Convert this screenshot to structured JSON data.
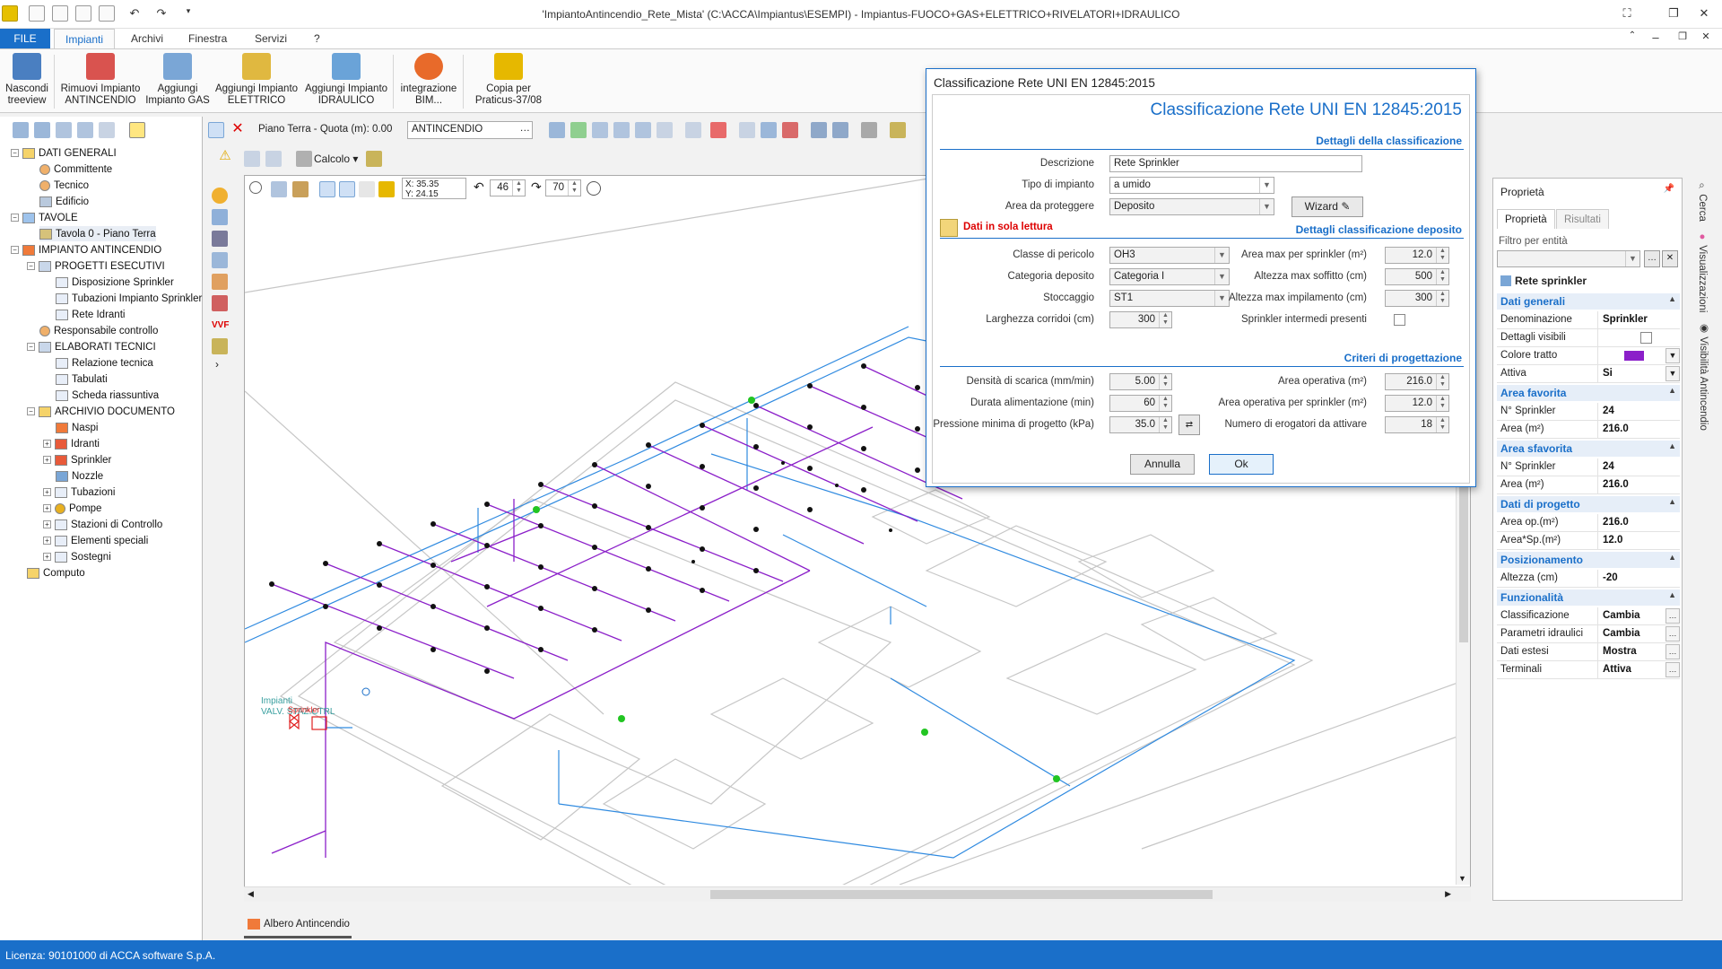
{
  "window": {
    "title": "'ImpiantoAntincendio_Rete_Mista' (C:\\ACCA\\Impiantus\\ESEMPI) - Impiantus-FUOCO+GAS+ELETTRICO+RIVELATORI+IDRAULICO"
  },
  "ribbon": {
    "tabs": [
      {
        "label": "FILE"
      },
      {
        "label": "Impianti"
      },
      {
        "label": "Archivi"
      },
      {
        "label": "Finestra"
      },
      {
        "label": "Servizi"
      },
      {
        "label": "?"
      }
    ],
    "buttons": [
      {
        "line1": "Nascondi",
        "line2": "treeview",
        "icon": "hide-tree-icon",
        "color": "#4a7fc1"
      },
      {
        "line1": "Rimuovi Impianto",
        "line2": "ANTINCENDIO",
        "icon": "remove-plant-icon",
        "color": "#d9534f"
      },
      {
        "line1": "Aggiungi",
        "line2": "Impianto GAS",
        "icon": "gas-plant-icon",
        "color": "#7aa6d6"
      },
      {
        "line1": "Aggiungi Impianto",
        "line2": "ELETTRICO",
        "icon": "electric-plant-icon",
        "color": "#e0b840"
      },
      {
        "line1": "Aggiungi Impianto",
        "line2": "IDRAULICO",
        "icon": "hydraulic-plant-icon",
        "color": "#6aa3d8"
      },
      {
        "line1": "integrazione",
        "line2": "BIM...",
        "icon": "bim-icon",
        "color": "#e86a2a"
      },
      {
        "line1": "Copia per",
        "line2": "Praticus-37/08",
        "icon": "praticus-icon",
        "color": "#e6b800"
      }
    ]
  },
  "tree": {
    "items": [
      {
        "label": "DATI GENERALI"
      },
      {
        "label": "Committente"
      },
      {
        "label": "Tecnico"
      },
      {
        "label": "Edificio"
      },
      {
        "label": "TAVOLE"
      },
      {
        "label": "Tavola 0 - Piano Terra"
      },
      {
        "label": "IMPIANTO ANTINCENDIO"
      },
      {
        "label": "PROGETTI ESECUTIVI"
      },
      {
        "label": "Disposizione Sprinkler"
      },
      {
        "label": "Tubazioni Impianto Sprinkler"
      },
      {
        "label": "Rete Idranti"
      },
      {
        "label": "Responsabile controllo"
      },
      {
        "label": "ELABORATI TECNICI"
      },
      {
        "label": "Relazione tecnica"
      },
      {
        "label": "Tabulati"
      },
      {
        "label": "Scheda riassuntiva"
      },
      {
        "label": "ARCHIVIO DOCUMENTO"
      },
      {
        "label": "Naspi"
      },
      {
        "label": "Idranti"
      },
      {
        "label": "Sprinkler"
      },
      {
        "label": "Nozzle"
      },
      {
        "label": "Tubazioni"
      },
      {
        "label": "Pompe"
      },
      {
        "label": "Stazioni di Controllo"
      },
      {
        "label": "Elementi speciali"
      },
      {
        "label": "Sostegni"
      },
      {
        "label": "Computo"
      }
    ]
  },
  "toolbar": {
    "floor": "Piano Terra - Quota (m): 0.00",
    "layer": "ANTINCENDIO",
    "calc": "Calcolo",
    "coord_x": "X: 35.35",
    "coord_y": "Y: 24.15",
    "angle1": "46",
    "angle2": "70"
  },
  "drawing": {
    "label_valv": "VALV. STAZ.CTRL",
    "label_sprinkler": "Sprinkler",
    "label_impianti": "Impianti"
  },
  "dialog": {
    "window_title": "Classificazione Rete UNI EN 12845:2015",
    "heading": "Classificazione Rete UNI EN 12845:2015",
    "section1": "Dettagli della classificazione",
    "descrizione_label": "Descrizione",
    "descrizione_value": "Rete Sprinkler",
    "tipo_label": "Tipo di impianto",
    "tipo_value": "a umido",
    "area_label": "Area da proteggere",
    "area_value": "Deposito",
    "wizard": "Wizard",
    "readonly": "Dati in sola lettura",
    "section2": "Dettagli classificazione deposito",
    "classe_label": "Classe di pericolo",
    "classe_value": "OH3",
    "categoria_label": "Categoria deposito",
    "categoria_value": "Categoria I",
    "stoccaggio_label": "Stoccaggio",
    "stoccaggio_value": "ST1",
    "larghezza_label": "Larghezza corridoi (cm)",
    "larghezza_value": "300",
    "areamax_label": "Area max per sprinkler (m²)",
    "areamax_value": "12.0",
    "altsoff_label": "Altezza max soffitto (cm)",
    "altsoff_value": "500",
    "altimp_label": "Altezza max impilamento (cm)",
    "altimp_value": "300",
    "intermedi_label": "Sprinkler intermedi presenti",
    "section3": "Criteri di progettazione",
    "densita_label": "Densità di scarica (mm/min)",
    "densita_value": "5.00",
    "durata_label": "Durata alimentazione (min)",
    "durata_value": "60",
    "pressione_label": "Pressione minima di progetto (kPa)",
    "pressione_value": "35.0",
    "areaop_label": "Area operativa (m²)",
    "areaop_value": "216.0",
    "areaopsp_label": "Area operativa per sprinkler (m²)",
    "areaopsp_value": "12.0",
    "numerog_label": "Numero di erogatori da attivare",
    "numerog_value": "18",
    "cancel": "Annulla",
    "ok": "Ok"
  },
  "props": {
    "title": "Proprietà",
    "tab1": "Proprietà",
    "tab2": "Risultati",
    "filter_label": "Filtro per entità",
    "entity": "Rete sprinkler",
    "groups": {
      "g1": "Dati generali",
      "g2": "Area favorita",
      "g3": "Area sfavorita",
      "g4": "Dati di progetto",
      "g5": "Posizionamento",
      "g6": "Funzionalità"
    },
    "rows": {
      "denominazione_k": "Denominazione",
      "denominazione_v": "Sprinkler",
      "dettagli_k": "Dettagli visibili",
      "colore_k": "Colore tratto",
      "colore_v": "#8b1fc9",
      "attiva_k": "Attiva",
      "attiva_v": "Si",
      "fav_n_k": "N° Sprinkler",
      "fav_n_v": "24",
      "fav_a_k": "Area  (m²)",
      "fav_a_v": "216.0",
      "sfav_n_k": "N° Sprinkler",
      "sfav_n_v": "24",
      "sfav_a_k": "Area (m²)",
      "sfav_a_v": "216.0",
      "op_k": "Area op.(m²)",
      "op_v": "216.0",
      "opsp_k": "Area*Sp.(m²)",
      "opsp_v": "12.0",
      "alt_k": "Altezza (cm)",
      "alt_v": "-20",
      "class_k": "Classificazione",
      "class_v": "Cambia",
      "param_k": "Parametri idraulici",
      "param_v": "Cambia",
      "estesi_k": "Dati estesi",
      "estesi_v": "Mostra",
      "term_k": "Terminali",
      "term_v": "Attiva"
    }
  },
  "sidetabs": {
    "cerca": "Cerca",
    "visualizzazioni": "Visualizzazioni",
    "visibilita": "Visibilità Antincendio"
  },
  "bottom_tab": "Albero Antincendio",
  "status": "Licenza: 90101000 di ACCA software S.p.A.",
  "colors": {
    "accent": "#1a6fc9",
    "pipe_purple": "#8b1fc9",
    "pipe_blue": "#2f8ae0"
  }
}
